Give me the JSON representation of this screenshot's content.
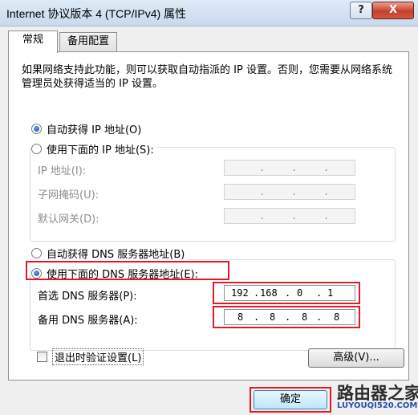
{
  "window": {
    "title": "Internet 协议版本 4 (TCP/IPv4) 属性",
    "help_glyph": "?",
    "close_glyph": "X"
  },
  "tabs": [
    {
      "label": "常规",
      "selected": true
    },
    {
      "label": "备用配置",
      "selected": false
    }
  ],
  "description": "如果网络支持此功能，则可以获取自动指派的 IP 设置。否则，您需要从网络系统管理员处获得适当的 IP 设置。",
  "ip_section": {
    "auto_label": "自动获得 IP 地址(O)",
    "auto_selected": true,
    "manual_label": "使用下面的 IP 地址(S):",
    "manual_selected": false,
    "ip_address_label": "IP 地址(I):",
    "subnet_mask_label": "子网掩码(U):",
    "gateway_label": "默认网关(D):"
  },
  "dns_section": {
    "auto_label": "自动获得 DNS 服务器地址(B)",
    "auto_selected": false,
    "manual_label": "使用下面的 DNS 服务器地址(E):",
    "manual_selected": true,
    "preferred_label": "首选 DNS 服务器(P):",
    "preferred_octets": [
      "192",
      "168",
      "0",
      "1"
    ],
    "alternate_label": "备用 DNS 服务器(A):",
    "alternate_octets": [
      "8",
      "8",
      "8",
      "8"
    ]
  },
  "validate_checkbox": {
    "label": "退出时验证设置(L)",
    "checked": false
  },
  "buttons": {
    "advanced": "高级(V)...",
    "ok": "确定"
  },
  "watermark": {
    "text": "路由器之家",
    "url": "LUYOUQI520.COM"
  },
  "colors": {
    "highlight": "#e0182a",
    "radio_on": "#1d4f9a"
  }
}
